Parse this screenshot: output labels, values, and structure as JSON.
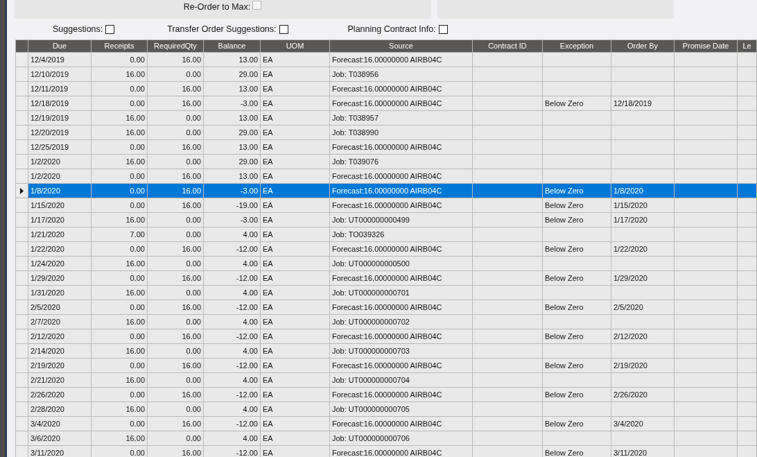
{
  "top_panel": {
    "reorder_to_max": {
      "label": "Re-Order to Max:",
      "checked": false,
      "disabled": true
    }
  },
  "options": [
    {
      "label": "Suggestions:",
      "checked": false
    },
    {
      "label": "Transfer Order Suggestions:",
      "checked": false
    },
    {
      "label": "Planning Contract Info:",
      "checked": false
    }
  ],
  "table": {
    "columns": [
      "Due",
      "Receipts",
      "RequiredQty",
      "Balance",
      "UOM",
      "Source",
      "Contract ID",
      "Exception",
      "Order By",
      "Promise Date",
      "Le"
    ],
    "rows": [
      {
        "due": "12/4/2019",
        "receipts": "0.00",
        "required_qty": "16.00",
        "balance": "13.00",
        "uom": "EA",
        "source": "Forecast:16.00000000 AIRB04C",
        "selected": false
      },
      {
        "due": "12/10/2019",
        "receipts": "16.00",
        "required_qty": "0.00",
        "balance": "29.00",
        "uom": "EA",
        "source": "Job: T038956",
        "selected": false
      },
      {
        "due": "12/11/2019",
        "receipts": "0.00",
        "required_qty": "16.00",
        "balance": "13.00",
        "uom": "EA",
        "source": "Forecast:16.00000000 AIRB04C",
        "selected": false
      },
      {
        "due": "12/18/2019",
        "receipts": "0.00",
        "required_qty": "16.00",
        "balance": "-3.00",
        "uom": "EA",
        "source": "Forecast:16.00000000 AIRB04C",
        "exception": "Below Zero",
        "order_by": "12/18/2019",
        "selected": false
      },
      {
        "due": "12/19/2019",
        "receipts": "16.00",
        "required_qty": "0.00",
        "balance": "13.00",
        "uom": "EA",
        "source": "Job: T038957",
        "selected": false
      },
      {
        "due": "12/20/2019",
        "receipts": "16.00",
        "required_qty": "0.00",
        "balance": "29.00",
        "uom": "EA",
        "source": "Job: T038990",
        "selected": false
      },
      {
        "due": "12/25/2019",
        "receipts": "0.00",
        "required_qty": "16.00",
        "balance": "13.00",
        "uom": "EA",
        "source": "Forecast:16.00000000 AIRB04C",
        "selected": false
      },
      {
        "due": "1/2/2020",
        "receipts": "16.00",
        "required_qty": "0.00",
        "balance": "29.00",
        "uom": "EA",
        "source": "Job: T039076",
        "selected": false
      },
      {
        "due": "1/2/2020",
        "receipts": "0.00",
        "required_qty": "16.00",
        "balance": "13.00",
        "uom": "EA",
        "source": "Forecast:16.00000000 AIRB04C",
        "selected": false
      },
      {
        "due": "1/8/2020",
        "receipts": "0.00",
        "required_qty": "16.00",
        "balance": "-3.00",
        "uom": "EA",
        "source": "Forecast:16.00000000 AIRB04C",
        "exception": "Below Zero",
        "order_by": "1/8/2020",
        "selected": true
      },
      {
        "due": "1/15/2020",
        "receipts": "0.00",
        "required_qty": "16.00",
        "balance": "-19.00",
        "uom": "EA",
        "source": "Forecast:16.00000000 AIRB04C",
        "exception": "Below Zero",
        "order_by": "1/15/2020",
        "selected": false
      },
      {
        "due": "1/17/2020",
        "receipts": "16.00",
        "required_qty": "0.00",
        "balance": "-3.00",
        "uom": "EA",
        "source": "Job: UT000000000499",
        "exception": "Below Zero",
        "order_by": "1/17/2020",
        "selected": false
      },
      {
        "due": "1/21/2020",
        "receipts": "7.00",
        "required_qty": "0.00",
        "balance": "4.00",
        "uom": "EA",
        "source": "Job: TO039326",
        "selected": false
      },
      {
        "due": "1/22/2020",
        "receipts": "0.00",
        "required_qty": "16.00",
        "balance": "-12.00",
        "uom": "EA",
        "source": "Forecast:16.00000000 AIRB04C",
        "exception": "Below Zero",
        "order_by": "1/22/2020",
        "selected": false
      },
      {
        "due": "1/24/2020",
        "receipts": "16.00",
        "required_qty": "0.00",
        "balance": "4.00",
        "uom": "EA",
        "source": "Job: UT000000000500",
        "selected": false
      },
      {
        "due": "1/29/2020",
        "receipts": "0.00",
        "required_qty": "16.00",
        "balance": "-12.00",
        "uom": "EA",
        "source": "Forecast:16.00000000 AIRB04C",
        "exception": "Below Zero",
        "order_by": "1/29/2020",
        "selected": false
      },
      {
        "due": "1/31/2020",
        "receipts": "16.00",
        "required_qty": "0.00",
        "balance": "4.00",
        "uom": "EA",
        "source": "Job: UT000000000701",
        "selected": false
      },
      {
        "due": "2/5/2020",
        "receipts": "0.00",
        "required_qty": "16.00",
        "balance": "-12.00",
        "uom": "EA",
        "source": "Forecast:16.00000000 AIRB04C",
        "exception": "Below Zero",
        "order_by": "2/5/2020",
        "selected": false
      },
      {
        "due": "2/7/2020",
        "receipts": "16.00",
        "required_qty": "0.00",
        "balance": "4.00",
        "uom": "EA",
        "source": "Job: UT000000000702",
        "selected": false
      },
      {
        "due": "2/12/2020",
        "receipts": "0.00",
        "required_qty": "16.00",
        "balance": "-12.00",
        "uom": "EA",
        "source": "Forecast:16.00000000 AIRB04C",
        "exception": "Below Zero",
        "order_by": "2/12/2020",
        "selected": false
      },
      {
        "due": "2/14/2020",
        "receipts": "16.00",
        "required_qty": "0.00",
        "balance": "4.00",
        "uom": "EA",
        "source": "Job: UT000000000703",
        "selected": false
      },
      {
        "due": "2/19/2020",
        "receipts": "0.00",
        "required_qty": "16.00",
        "balance": "-12.00",
        "uom": "EA",
        "source": "Forecast:16.00000000 AIRB04C",
        "exception": "Below Zero",
        "order_by": "2/19/2020",
        "selected": false
      },
      {
        "due": "2/21/2020",
        "receipts": "16.00",
        "required_qty": "0.00",
        "balance": "4.00",
        "uom": "EA",
        "source": "Job: UT000000000704",
        "selected": false
      },
      {
        "due": "2/26/2020",
        "receipts": "0.00",
        "required_qty": "16.00",
        "balance": "-12.00",
        "uom": "EA",
        "source": "Forecast:16.00000000 AIRB04C",
        "exception": "Below Zero",
        "order_by": "2/26/2020",
        "selected": false
      },
      {
        "due": "2/28/2020",
        "receipts": "16.00",
        "required_qty": "0.00",
        "balance": "4.00",
        "uom": "EA",
        "source": "Job: UT000000000705",
        "selected": false
      },
      {
        "due": "3/4/2020",
        "receipts": "0.00",
        "required_qty": "16.00",
        "balance": "-12.00",
        "uom": "EA",
        "source": "Forecast:16.00000000 AIRB04C",
        "exception": "Below Zero",
        "order_by": "3/4/2020",
        "selected": false
      },
      {
        "due": "3/6/2020",
        "receipts": "16.00",
        "required_qty": "0.00",
        "balance": "4.00",
        "uom": "EA",
        "source": "Job: UT000000000706",
        "selected": false
      },
      {
        "due": "3/11/2020",
        "receipts": "0.00",
        "required_qty": "16.00",
        "balance": "-12.00",
        "uom": "EA",
        "source": "Forecast:16.00000000 AIRB04C",
        "exception": "Below Zero",
        "order_by": "3/11/2020",
        "selected": false
      }
    ]
  }
}
